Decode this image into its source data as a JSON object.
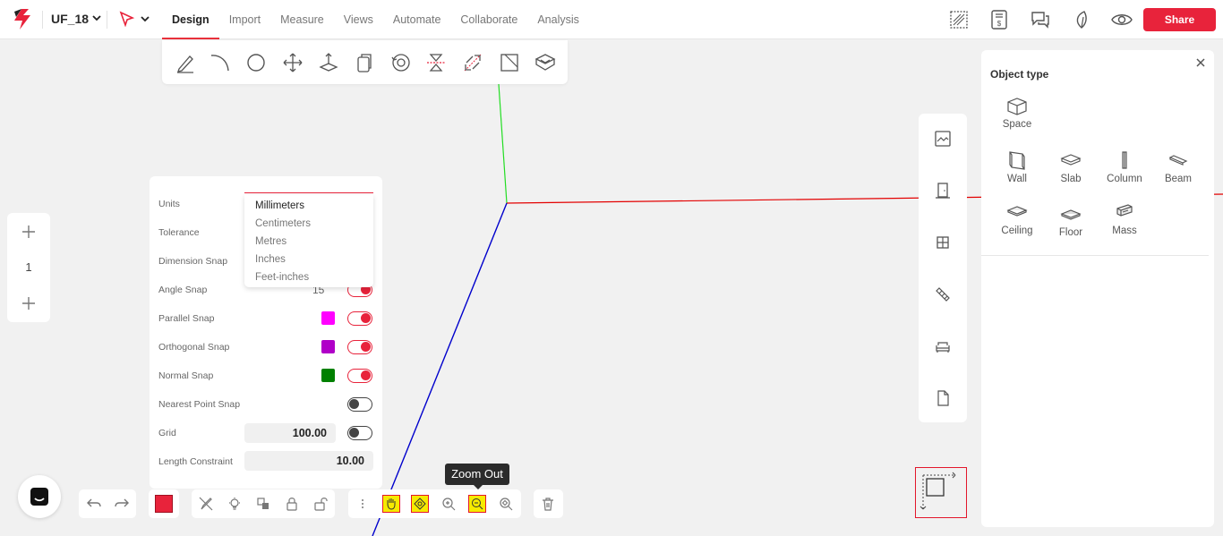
{
  "app": {
    "project_name": "UF_18"
  },
  "menu": [
    "Design",
    "Import",
    "Measure",
    "Views",
    "Automate",
    "Collaborate",
    "Analysis"
  ],
  "share_label": "Share",
  "design_tools": [
    "pencil-icon",
    "arc-icon",
    "circle-icon",
    "move-icon",
    "push-pull-icon",
    "copy-icon",
    "rotate-icon",
    "mirror-icon",
    "scale-icon",
    "offset-icon",
    "extrude-icon"
  ],
  "top_right_icons": [
    "render-icon",
    "cost-report-icon",
    "comments-icon",
    "sustainability-leaf-icon",
    "view-eye-icon"
  ],
  "zoom_widget": {
    "level": "1"
  },
  "settings": {
    "units_label": "Units",
    "tolerance_label": "Tolerance",
    "dimension_snap_label": "Dimension Snap",
    "angle_snap_label": "Angle Snap",
    "angle_snap_value": "15",
    "parallel_snap_label": "Parallel Snap",
    "orthogonal_snap_label": "Orthogonal Snap",
    "normal_snap_label": "Normal Snap",
    "nearest_point_snap_label": "Nearest Point Snap",
    "grid_label": "Grid",
    "grid_value": "100.00",
    "length_constraint_label": "Length Constraint",
    "length_constraint_value": "10.00",
    "colors": {
      "parallel": "#ff00ff",
      "orthogonal": "#b000c8",
      "normal": "#008000"
    },
    "units_options": [
      "Millimeters",
      "Centimeters",
      "Metres",
      "Inches",
      "Feet-inches"
    ],
    "units_selected": "Millimeters"
  },
  "bottom_toolbar": {
    "tooltip": "Zoom Out",
    "icons": [
      "undo-icon",
      "redo-icon",
      "select-color-icon",
      "brush-icon",
      "light-icon",
      "group-icon",
      "lock-icon",
      "unlock-icon",
      "more-icon",
      "pan-hand-icon",
      "orbit-icon",
      "zoom-in-icon",
      "zoom-out-icon",
      "zoom-extents-icon",
      "delete-icon"
    ]
  },
  "right_toolbar_icons": [
    "picture-icon",
    "door-icon",
    "window-icon",
    "stair-icon",
    "furniture-sofa-icon",
    "file-icon"
  ],
  "object_panel": {
    "title": "Object type",
    "items": [
      {
        "label": "Space",
        "icon": "cube-icon"
      },
      {
        "label": "Wall",
        "icon": "wall-icon"
      },
      {
        "label": "Slab",
        "icon": "slab-icon"
      },
      {
        "label": "Column",
        "icon": "column-icon"
      },
      {
        "label": "Beam",
        "icon": "beam-icon"
      },
      {
        "label": "Ceiling",
        "icon": "ceiling-icon"
      },
      {
        "label": "Floor",
        "icon": "floor-icon"
      },
      {
        "label": "Mass",
        "icon": "mass-icon"
      }
    ]
  },
  "colors": {
    "accent": "#e8233b",
    "axis_x": "#e30000",
    "axis_y": "#22cc22",
    "axis_z": "#0000cc"
  }
}
